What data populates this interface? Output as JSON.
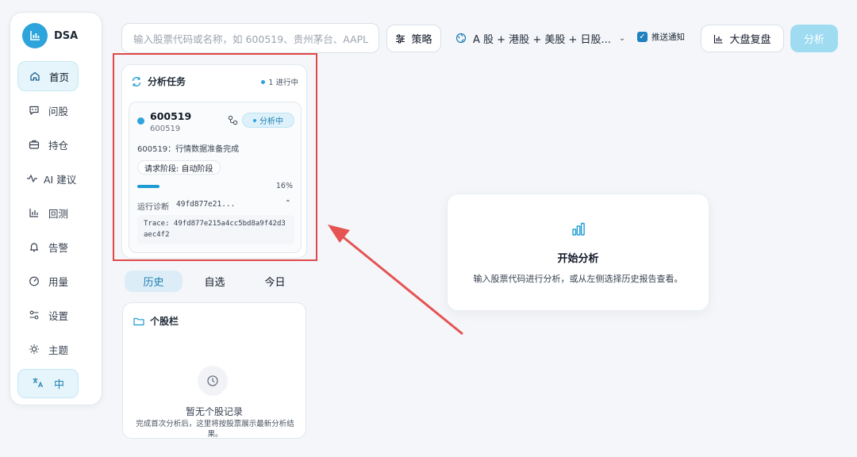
{
  "brand": {
    "name": "DSA"
  },
  "sidebar": {
    "items": [
      {
        "label": "首页",
        "icon": "home-icon",
        "active": true
      },
      {
        "label": "问股",
        "icon": "chat-icon"
      },
      {
        "label": "持仓",
        "icon": "briefcase-icon"
      },
      {
        "label": "AI 建议",
        "icon": "pulse-icon"
      },
      {
        "label": "回测",
        "icon": "bar-chart-icon"
      },
      {
        "label": "告警",
        "icon": "bell-icon"
      },
      {
        "label": "用量",
        "icon": "gauge-icon"
      },
      {
        "label": "设置",
        "icon": "settings-icon"
      },
      {
        "label": "主题",
        "icon": "sun-icon"
      }
    ],
    "language": "中"
  },
  "topbar": {
    "search_placeholder": "输入股票代码或名称，如 600519、贵州茅台、AAPL",
    "strategy_label": "策略",
    "market_select": "A 股 + 港股 + 美股 + 日股...",
    "notify_label": "推送通知",
    "notify_checked": true,
    "market_review_label": "大盘复盘",
    "analyze_label": "分析"
  },
  "task_panel": {
    "title": "分析任务",
    "running_text": "1 进行中",
    "task": {
      "code": "600519",
      "subcode": "600519",
      "status": "分析中",
      "message": "600519：行情数据准备完成",
      "stage": "请求阶段: 自动阶段",
      "progress_percent": 16,
      "progress_text": "16%",
      "diagnostic_label": "运行诊断",
      "diagnostic_id": "49fd877e21...",
      "trace": "Trace: 49fd877e215a4cc5bd8a9f42d3aec4f2"
    }
  },
  "tabs": [
    {
      "label": "历史",
      "active": true
    },
    {
      "label": "自选"
    },
    {
      "label": "今日"
    }
  ],
  "stock_panel": {
    "title": "个股栏",
    "empty_title": "暂无个股记录",
    "empty_desc": "完成首次分析后，这里将按股票展示最新分析结果。"
  },
  "start_card": {
    "title": "开始分析",
    "desc": "输入股票代码进行分析，或从左侧选择历史报告查看。"
  },
  "colors": {
    "accent": "#2ea4dc",
    "highlight": "#e04848",
    "active_bg": "#e6f5fb"
  }
}
